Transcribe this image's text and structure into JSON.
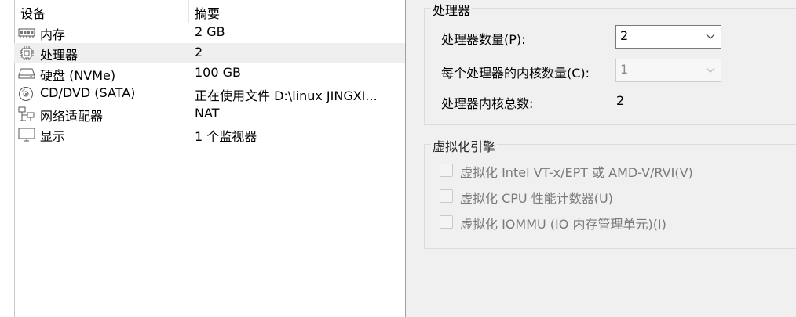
{
  "device_list": {
    "headers": {
      "device": "设备",
      "summary": "摘要"
    },
    "rows": [
      {
        "icon": "memory-icon",
        "name": "内存",
        "summary": "2 GB"
      },
      {
        "icon": "processor-icon",
        "name": "处理器",
        "summary": "2"
      },
      {
        "icon": "hard-disk-icon",
        "name": "硬盘 (NVMe)",
        "summary": "100 GB"
      },
      {
        "icon": "cd-dvd-icon",
        "name": "CD/DVD (SATA)",
        "summary": "正在使用文件 D:\\linux JINGXI..."
      },
      {
        "icon": "network-adapter-icon",
        "name": "网络适配器",
        "summary": "NAT"
      },
      {
        "icon": "display-icon",
        "name": "显示",
        "summary": "1 个监视器"
      }
    ],
    "selected_index": 1
  },
  "processor": {
    "group_title": "处理器",
    "count_label": "处理器数量(P):",
    "count_value": "2",
    "cores_label": "每个处理器的内核数量(C):",
    "cores_value": "1",
    "total_label": "处理器内核总数:",
    "total_value": "2"
  },
  "virtualization": {
    "group_title": "虚拟化引擎",
    "options": [
      {
        "label": "虚拟化 Intel VT-x/EPT 或 AMD-V/RVI(V)",
        "checked": false,
        "enabled": false
      },
      {
        "label": "虚拟化 CPU 性能计数器(U)",
        "checked": false,
        "enabled": false
      },
      {
        "label": "虚拟化 IOMMU (IO 内存管理单元)(I)",
        "checked": false,
        "enabled": false
      }
    ]
  },
  "colors": {
    "selected_row": "#efefef",
    "panel_bg": "#f0f0f0",
    "disabled_text": "#7a7a7a"
  }
}
